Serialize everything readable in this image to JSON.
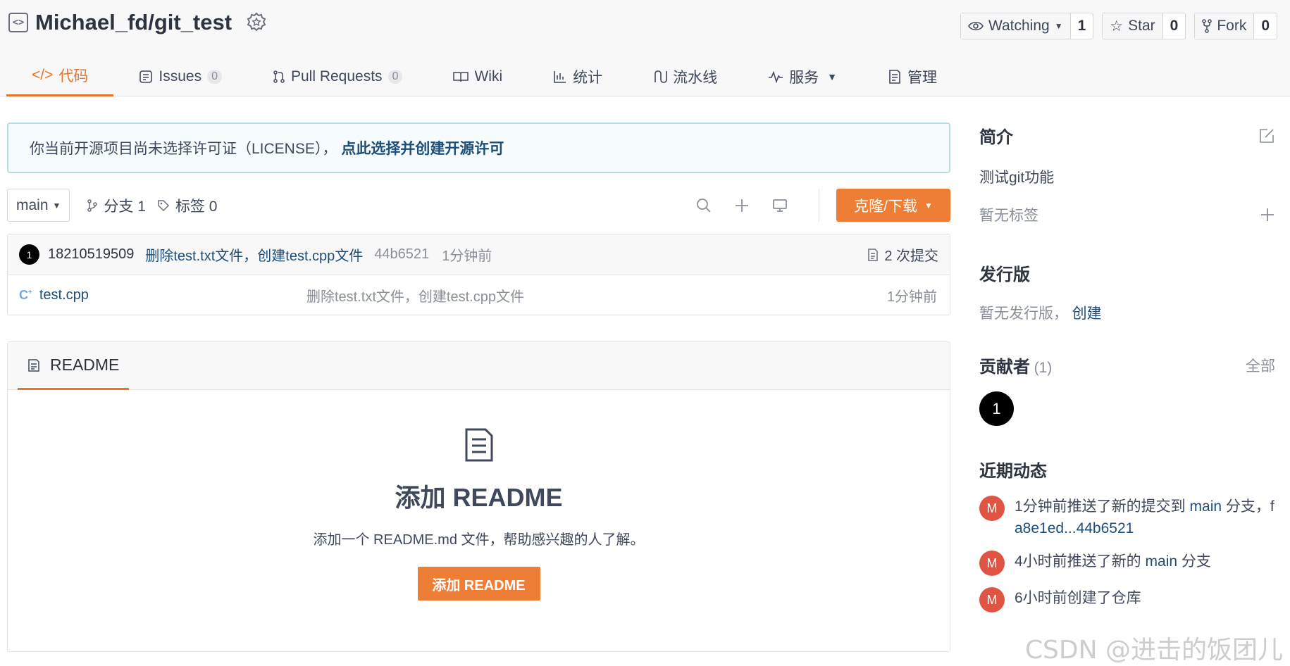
{
  "repo": {
    "icon": "code-repo-icon",
    "name": "Michael_fd/git_test",
    "badge_icon": "recommend-badge-icon"
  },
  "actions": {
    "watch": {
      "label": "Watching",
      "count": "1"
    },
    "star": {
      "label": "Star",
      "count": "0"
    },
    "fork": {
      "label": "Fork",
      "count": "0"
    }
  },
  "tabs": [
    {
      "label": "代码",
      "icon": "code-icon",
      "active": true
    },
    {
      "label": "Issues",
      "count": "0",
      "icon": "issues-icon"
    },
    {
      "label": "Pull Requests",
      "count": "0",
      "icon": "pull-request-icon"
    },
    {
      "label": "Wiki",
      "icon": "wiki-icon"
    },
    {
      "label": "统计",
      "icon": "stats-icon"
    },
    {
      "label": "流水线",
      "icon": "pipeline-icon"
    },
    {
      "label": "服务",
      "icon": "service-icon"
    },
    {
      "label": "管理",
      "icon": "manage-icon"
    }
  ],
  "license_notice": {
    "text": "你当前开源项目尚未选择许可证（LICENSE），",
    "link": "点此选择并创建开源许可"
  },
  "branchbar": {
    "branch": "main",
    "branches": "分支 1",
    "tags": "标签 0",
    "clone_label": "克隆/下载"
  },
  "commit": {
    "avatar": "1",
    "author": "18210519509",
    "message": "删除test.txt文件，创建test.cpp文件",
    "sha": "44b6521",
    "time": "1分钟前",
    "commits": "2 次提交"
  },
  "files": [
    {
      "name": "test.cpp",
      "message": "删除test.txt文件，创建test.cpp文件",
      "time": "1分钟前"
    }
  ],
  "readme": {
    "tab": "README",
    "title": "添加 README",
    "desc": "添加一个 README.md 文件，帮助感兴趣的人了解。",
    "button": "添加 README"
  },
  "sidebar": {
    "intro_title": "简介",
    "intro_desc": "测试git功能",
    "no_tags": "暂无标签",
    "release_title": "发行版",
    "no_release": "暂无发行版，",
    "create": "创建",
    "contrib_title": "贡献者",
    "contrib_count": "(1)",
    "all": "全部",
    "contrib_avatar": "1",
    "activity_title": "近期动态",
    "activity": [
      {
        "avatar": "M",
        "pre": "1分钟前推送了新的提交到 ",
        "link": "main",
        "post": " 分支，f",
        "line2": "a8e1ed...44b6521"
      },
      {
        "avatar": "M",
        "pre": "4小时前推送了新的 ",
        "link": "main",
        "post": " 分支",
        "line2": ""
      },
      {
        "avatar": "M",
        "pre": "6小时前创建了仓库",
        "link": "",
        "post": "",
        "line2": ""
      }
    ]
  },
  "watermark": "CSDN @进击的饭团儿"
}
